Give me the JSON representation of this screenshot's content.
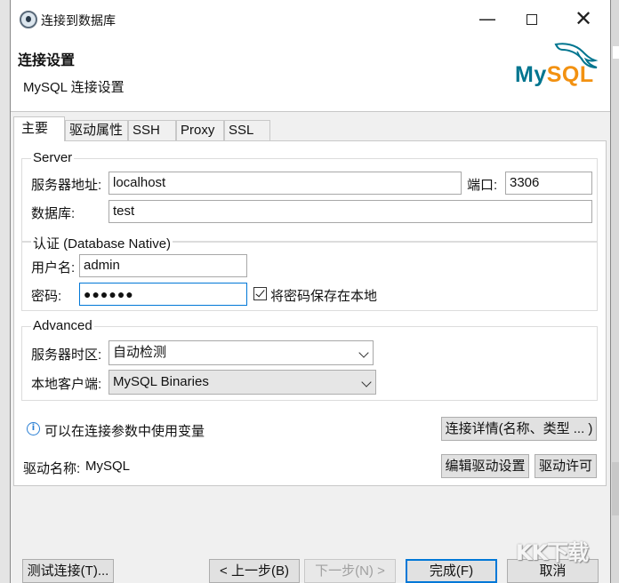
{
  "window": {
    "title": "连接到数据库",
    "minimize_glyph": "—",
    "close_glyph": "✕"
  },
  "header": {
    "title": "连接设置",
    "subtitle": "MySQL 连接设置",
    "logo_text_my": "My",
    "logo_text_sql": "SQL",
    "logo_colors": {
      "my": "#00758f",
      "sql": "#f29111"
    }
  },
  "tabs": [
    {
      "label": "主要",
      "active": true
    },
    {
      "label": "驱动属性"
    },
    {
      "label": "SSH"
    },
    {
      "label": "Proxy"
    },
    {
      "label": "SSL"
    }
  ],
  "server": {
    "legend": "Server",
    "host_label": "服务器地址:",
    "host_value": "localhost",
    "port_label": "端口:",
    "port_value": "3306",
    "database_label": "数据库:",
    "database_value": "test"
  },
  "auth": {
    "legend": "认证 (Database Native)",
    "user_label": "用户名:",
    "user_value": "admin",
    "password_label": "密码:",
    "password_value": "●●●●●●",
    "save_password_label": "将密码保存在本地",
    "save_password_checked": true
  },
  "advanced": {
    "legend": "Advanced",
    "timezone_label": "服务器时区:",
    "timezone_value": "自动检测",
    "client_label": "本地客户端:",
    "client_value": "MySQL Binaries"
  },
  "info": {
    "text": "可以在连接参数中使用变量",
    "icon_glyph": "i",
    "details_button": "连接详情(名称、类型 ... )"
  },
  "driver": {
    "label": "驱动名称:",
    "value": "MySQL",
    "edit_button": "编辑驱动设置",
    "license_button": "驱动许可"
  },
  "footer": {
    "test_button": "测试连接(T)...",
    "back_button": "< 上一步(B)",
    "next_button": "下一步(N) >",
    "finish_button": "完成(F)",
    "cancel_button": "取消"
  },
  "watermark": "KK下载",
  "colors": {
    "accent": "#0078d7",
    "info_blue": "#2a7fd4"
  }
}
